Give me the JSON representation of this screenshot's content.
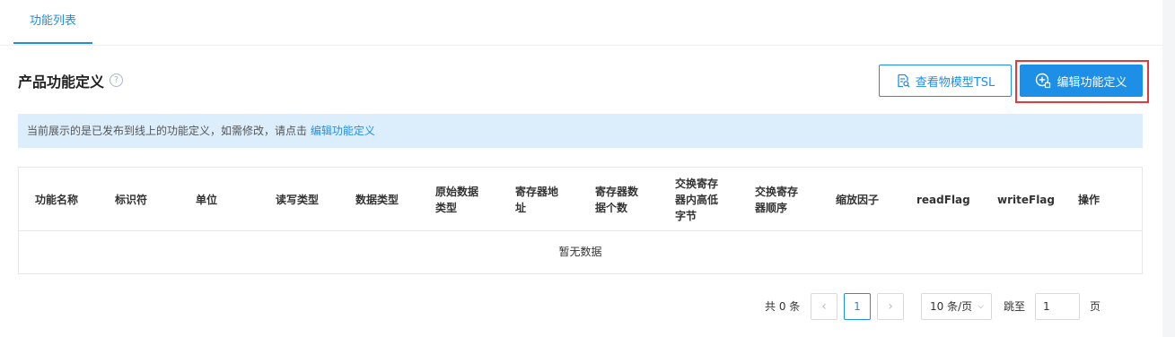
{
  "tabs": [
    {
      "label": "功能列表"
    }
  ],
  "page": {
    "title": "产品功能定义",
    "help_icon": "?"
  },
  "actions": {
    "tsl_label": "查看物模型TSL",
    "edit_label": "编辑功能定义"
  },
  "notice": {
    "text": "当前展示的是已发布到线上的功能定义，如需修改，请点击 ",
    "link": "编辑功能定义"
  },
  "table": {
    "headers": [
      "功能名称",
      "标识符",
      "单位",
      "读写类型",
      "数据类型",
      "原始数据类型",
      "寄存器地址",
      "寄存器数据个数",
      "交换寄存器内高低字节",
      "交换寄存器顺序",
      "缩放因子",
      "readFlag",
      "writeFlag",
      "操作"
    ],
    "empty_text": "暂无数据"
  },
  "pagination": {
    "total_text": "共 0 条",
    "current_page": "1",
    "prev": "‹",
    "next": "›",
    "page_size": "10 条/页",
    "goto_label": "跳至",
    "goto_value": "1",
    "page_unit": "页"
  },
  "colors": {
    "accent": "#1e8fe6",
    "highlight": "#e03b3b",
    "notice_bg": "#dceefc"
  }
}
